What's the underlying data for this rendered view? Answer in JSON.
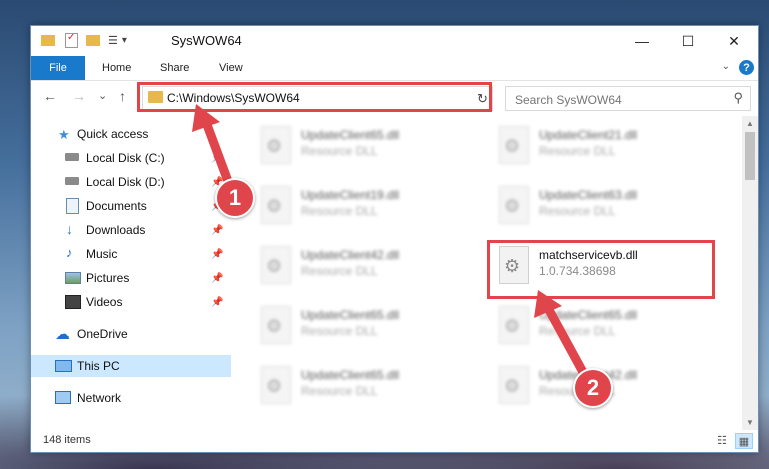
{
  "window": {
    "title": "SysWOW64",
    "minimize": "—",
    "maximize": "☐",
    "close": "✕"
  },
  "ribbon": {
    "tabs": [
      {
        "label": "File"
      },
      {
        "label": "Home"
      },
      {
        "label": "Share"
      },
      {
        "label": "View"
      }
    ],
    "help": "?",
    "accent_color": "#1979ca"
  },
  "nav": {
    "back": "←",
    "forward": "→",
    "recent": "⌄",
    "up": "↑",
    "address_path": "C:\\Windows\\SysWOW64",
    "address_dropdown": "⌄",
    "refresh": "↻",
    "search_placeholder": "Search SysWOW64",
    "search_icon": "⚲"
  },
  "sidebar": {
    "items": [
      {
        "label": "Quick access",
        "icon": "star-icon",
        "pinned": false
      },
      {
        "label": "Local Disk (C:)",
        "icon": "drive-icon",
        "pinned": true
      },
      {
        "label": "Local Disk (D:)",
        "icon": "drive-icon",
        "pinned": true
      },
      {
        "label": "Documents",
        "icon": "document-icon",
        "pinned": true
      },
      {
        "label": "Downloads",
        "icon": "download-icon",
        "pinned": true
      },
      {
        "label": "Music",
        "icon": "music-icon",
        "pinned": true
      },
      {
        "label": "Pictures",
        "icon": "pictures-icon",
        "pinned": true
      },
      {
        "label": "Videos",
        "icon": "video-icon",
        "pinned": true
      },
      {
        "label": "OneDrive",
        "icon": "cloud-icon",
        "pinned": false
      },
      {
        "label": "This PC",
        "icon": "computer-icon",
        "pinned": false,
        "selected": true
      },
      {
        "label": "Network",
        "icon": "network-icon",
        "pinned": false
      }
    ],
    "pin_glyph": "📌"
  },
  "files": [
    {
      "name": "UpdateClient65.dll",
      "meta": "Resource DLL",
      "blurred": true
    },
    {
      "name": "UpdateClient21.dll",
      "meta": "Resource DLL",
      "blurred": true
    },
    {
      "name": "UpdateClient19.dll",
      "meta": "Resource DLL",
      "blurred": true
    },
    {
      "name": "UpdateClient63.dll",
      "meta": "Resource DLL",
      "blurred": true
    },
    {
      "name": "UpdateClient42.dll",
      "meta": "Resource DLL",
      "blurred": true
    },
    {
      "name": "matchservicevb.dll",
      "meta": "1.0.734.38698",
      "blurred": false
    },
    {
      "name": "UpdateClient65.dll",
      "meta": "Resource DLL",
      "blurred": true
    },
    {
      "name": "UpdateClient65.dll",
      "meta": "Resource DLL",
      "blurred": true
    },
    {
      "name": "UpdateClient65.dll",
      "meta": "Resource DLL",
      "blurred": true
    },
    {
      "name": "UpdateClient42.dll",
      "meta": "Resource DLL",
      "blurred": true
    }
  ],
  "status": {
    "item_count": "148 items"
  },
  "annotations": {
    "step1": "1",
    "step2": "2",
    "color": "#e0454b"
  }
}
